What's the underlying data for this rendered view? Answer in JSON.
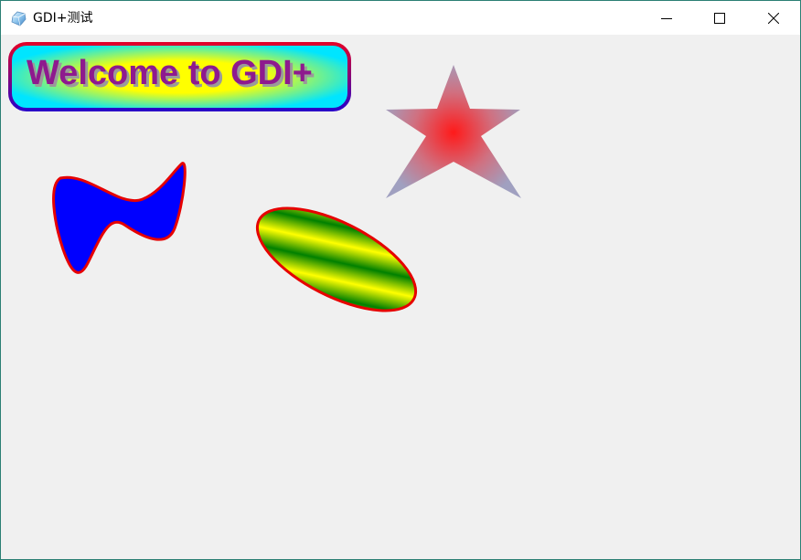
{
  "window": {
    "title": "GDI+测试",
    "icon": "gem-app-icon",
    "buttons": {
      "minimize": "minimize-icon",
      "maximize": "maximize-icon",
      "close": "close-icon"
    }
  },
  "canvas": {
    "banner_text": "Welcome to GDI+",
    "colors": {
      "text": "#8e1a8e",
      "text_shadow": "#9a9a9a",
      "banner_border_top": "#e0002a",
      "banner_border_bottom": "#2a00c8",
      "banner_fill_outer": "#00e5ff",
      "banner_fill_inner": "#ffff00",
      "blob_fill": "#0000ff",
      "outline": "#e60000",
      "ellipse_stripe_a": "#ffff00",
      "ellipse_stripe_b": "#008000",
      "star_center": "#ff1a1a",
      "star_edge_green": "#7ddc7d",
      "star_edge_blue": "#9b8cdc"
    }
  }
}
